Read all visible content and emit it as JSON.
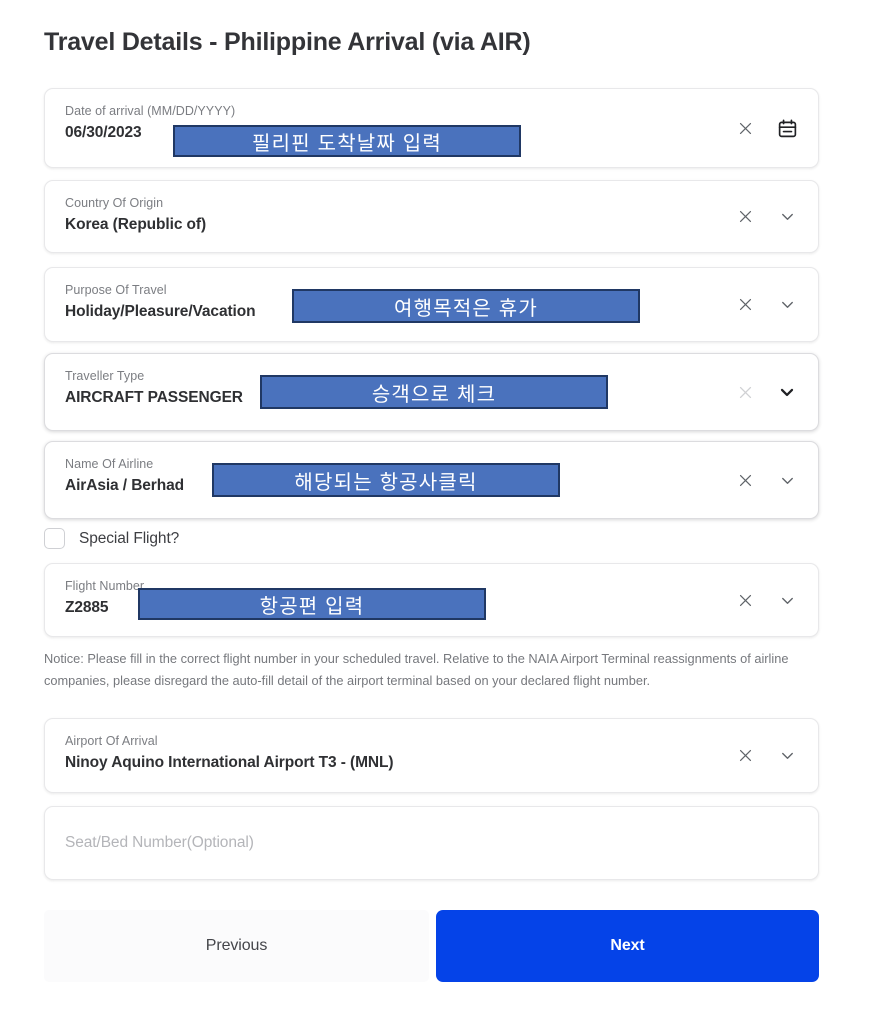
{
  "page": {
    "title": "Travel Details - Philippine Arrival (via AIR)"
  },
  "fields": {
    "date_of_arrival": {
      "label": "Date of arrival (MM/DD/YYYY)",
      "value": "06/30/2023",
      "clear_icon": "close-icon",
      "trailing_icon": "calendar-icon"
    },
    "country_of_origin": {
      "label": "Country Of Origin",
      "value": "Korea (Republic of)",
      "clear_icon": "close-icon",
      "trailing_icon": "chevron-down-icon"
    },
    "purpose_of_travel": {
      "label": "Purpose Of Travel",
      "value": "Holiday/Pleasure/Vacation",
      "clear_icon": "close-icon",
      "trailing_icon": "chevron-down-icon"
    },
    "traveller_type": {
      "label": "Traveller Type",
      "value": "AIRCRAFT PASSENGER",
      "clear_icon": "close-icon",
      "trailing_icon": "chevron-down-icon"
    },
    "name_of_airline": {
      "label": "Name Of Airline",
      "value": "AirAsia / Berhad",
      "clear_icon": "close-icon",
      "trailing_icon": "chevron-down-icon"
    },
    "special_flight": {
      "label": "Special Flight?",
      "checked": false
    },
    "flight_number": {
      "label": "Flight Number",
      "value": "Z2885",
      "clear_icon": "close-icon",
      "trailing_icon": "chevron-down-icon"
    },
    "airport_of_arrival": {
      "label": "Airport Of Arrival",
      "value": "Ninoy Aquino International Airport T3 - (MNL)",
      "clear_icon": "close-icon",
      "trailing_icon": "chevron-down-icon"
    },
    "seat_bed_number": {
      "placeholder": "Seat/Bed Number(Optional)",
      "value": ""
    }
  },
  "notice": {
    "text": "Notice: Please fill in the correct flight number in your scheduled travel. Relative to the NAIA Airport Terminal reassignments of airline companies, please disregard the auto-fill detail of the airport terminal based on your declared flight number."
  },
  "annotations": {
    "date": "필리핀 도착날짜 입력",
    "purpose": "여행목적은 휴가",
    "traveller": "승객으로 체크",
    "airline": "해당되는 항공사클릭",
    "flight": "항공편 입력"
  },
  "footer": {
    "previous_label": "Previous",
    "next_label": "Next"
  },
  "colors": {
    "primary_blue": "#0543e8",
    "annotation_fill": "#4a72bd",
    "annotation_border": "#203864",
    "card_border": "#e8e8ea",
    "label_gray": "#7b7d82"
  }
}
